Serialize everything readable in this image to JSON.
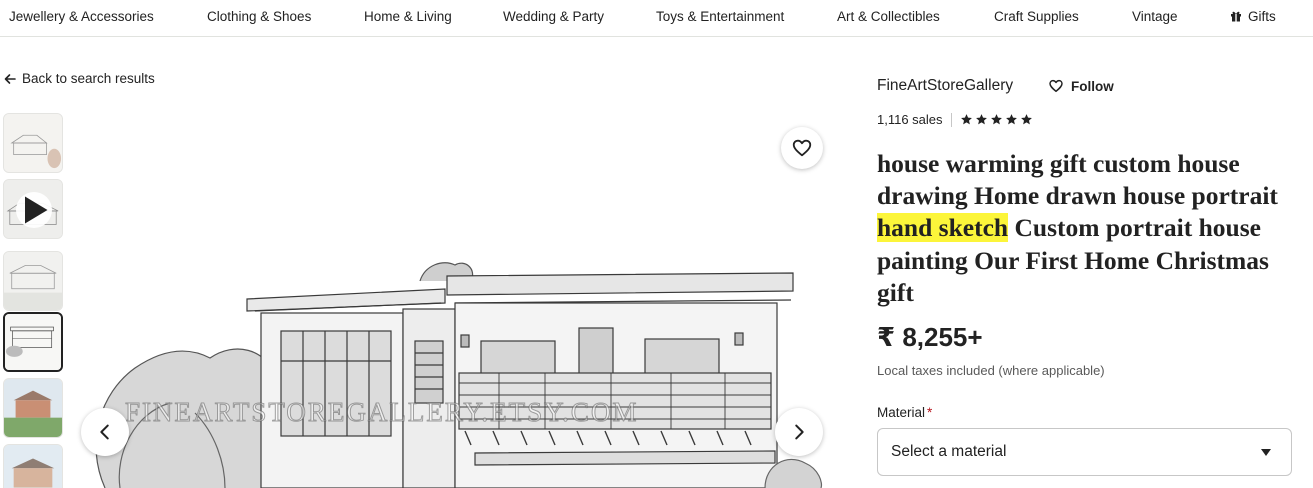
{
  "nav": {
    "items": [
      "Jewellery & Accessories",
      "Clothing & Shoes",
      "Home & Living",
      "Wedding & Party",
      "Toys & Entertainment",
      "Art & Collectibles",
      "Craft Supplies",
      "Vintage",
      "Gifts"
    ],
    "gifts_icon": "gift-icon"
  },
  "back_link": "Back to search results",
  "gallery": {
    "watermark": "FINEARTSTOREGALLERY.ETSY.COM",
    "icons": {
      "favorite": "heart-icon",
      "prev": "chevron-left-icon",
      "next": "chevron-right-icon",
      "video": "play-icon"
    }
  },
  "shop": {
    "name": "FineArtStoreGallery",
    "follow_label": "Follow",
    "sales": "1,116 sales",
    "rating_stars": 5
  },
  "listing": {
    "title_before": "house warming gift custom house drawing Home drawn house portrait ",
    "title_highlight": "hand sketch",
    "title_after": " Custom portrait house painting Our First Home Christmas gift",
    "price": "₹ 8,255+",
    "tax_note": "Local taxes included (where applicable)",
    "material_label": "Material",
    "material_required_mark": "*",
    "material_placeholder": "Select a material"
  },
  "colors": {
    "highlight": "#fcf53a",
    "required": "#b5121b",
    "text": "#222222"
  }
}
